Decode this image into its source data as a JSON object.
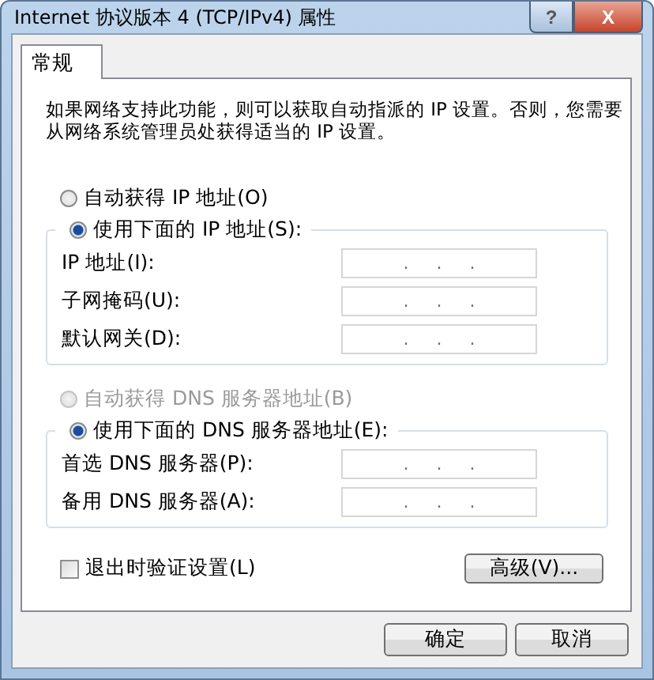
{
  "window": {
    "title": "Internet 协议版本 4 (TCP/IPv4) 属性",
    "help_button": "?",
    "close_button": "X"
  },
  "tabs": [
    {
      "label": "常规",
      "selected": true
    }
  ],
  "description": "如果网络支持此功能，则可以获取自动指派的 IP 设置。否则，您需要从网络系统管理员处获得适当的 IP 设置。",
  "ip_section": {
    "auto_option": {
      "label": "自动获得 IP 地址(O)",
      "selected": false,
      "disabled": false
    },
    "manual_option": {
      "label": "使用下面的 IP 地址(S):",
      "selected": true,
      "disabled": false
    },
    "fields": [
      {
        "label": "IP 地址(I):",
        "value": ".     .     ."
      },
      {
        "label": "子网掩码(U):",
        "value": ".     .     ."
      },
      {
        "label": "默认网关(D):",
        "value": ".     .     ."
      }
    ]
  },
  "dns_section": {
    "auto_option": {
      "label": "自动获得 DNS 服务器地址(B)",
      "selected": false,
      "disabled": true
    },
    "manual_option": {
      "label": "使用下面的 DNS 服务器地址(E):",
      "selected": true,
      "disabled": false
    },
    "fields": [
      {
        "label": "首选 DNS 服务器(P):",
        "value": ".     .     ."
      },
      {
        "label": "备用 DNS 服务器(A):",
        "value": ".     .     ."
      }
    ]
  },
  "validate_checkbox": {
    "label": "退出时验证设置(L)",
    "checked": false
  },
  "advanced_button": "高级(V)...",
  "buttons": [
    "确定",
    "取消"
  ]
}
